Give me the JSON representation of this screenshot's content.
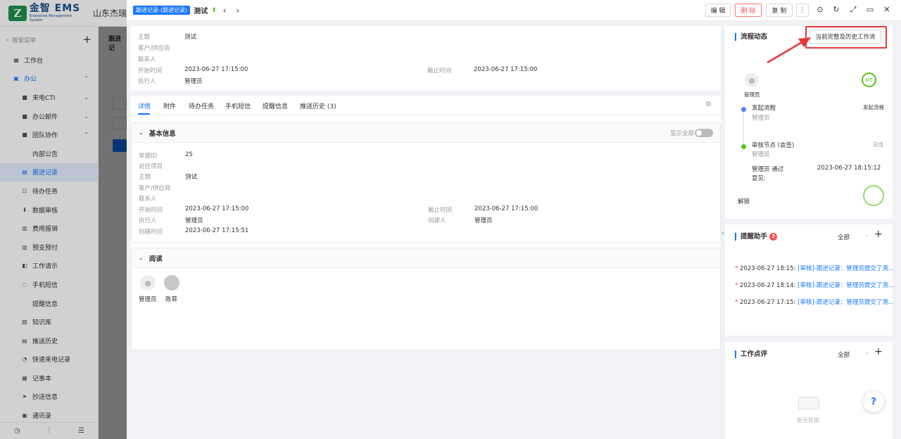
{
  "app": {
    "logo_mark": "Z",
    "name": "金智 EMS",
    "subtitle": "Enterprise Management System",
    "company": "山东杰瑞"
  },
  "sidebar": {
    "search_placeholder": "搜索菜单",
    "items": [
      {
        "label": "工作台",
        "icon": "dashboard-icon"
      },
      {
        "label": "办公",
        "icon": "office-icon"
      },
      {
        "label": "来电CTI",
        "icon": "phone-icon"
      },
      {
        "label": "办公邮件",
        "icon": "mail-icon"
      },
      {
        "label": "团队协作",
        "icon": "team-icon"
      },
      {
        "label": "内部公告"
      },
      {
        "label": "跟进记录",
        "icon": "followup-icon"
      },
      {
        "label": "待办任务",
        "icon": "todo-icon"
      },
      {
        "label": "数据审核",
        "icon": "audit-icon"
      },
      {
        "label": "费用报销",
        "icon": "expense-icon"
      },
      {
        "label": "预支预付",
        "icon": "prepay-icon"
      },
      {
        "label": "工作请示",
        "icon": "request-icon"
      },
      {
        "label": "手机短信",
        "icon": "sms-icon"
      },
      {
        "label": "提醒信息"
      },
      {
        "label": "知识库",
        "icon": "knowledge-icon"
      },
      {
        "label": "推送历史",
        "icon": "push-icon"
      },
      {
        "label": "快速来电记录",
        "icon": "quick-call-icon"
      },
      {
        "label": "记事本",
        "icon": "notebook-icon"
      },
      {
        "label": "抄送信息",
        "icon": "cc-icon"
      },
      {
        "label": "通讯录",
        "icon": "contacts-icon"
      }
    ]
  },
  "bg": {
    "tab_label": "跟进记"
  },
  "drawer": {
    "tag": "跟进记录-(跟进记录)",
    "title": "测试",
    "buttons": {
      "edit": "编 辑",
      "delete": "删 除",
      "copy": "复 制",
      "more": "⋮"
    },
    "summary": {
      "subject_label": "主题",
      "subject_value": "测试",
      "customer_label": "客户/供应商",
      "contact_label": "联系人",
      "start_label": "开始时间",
      "start_value": "2023-06-27 17:15:00",
      "end_label": "截止时间",
      "end_value": "2023-06-27 17:15:00",
      "exec_label": "执行人",
      "exec_value": "管理员"
    },
    "tabs": [
      "详情",
      "附件",
      "待办任务",
      "手机短信",
      "提醒信息",
      "推送历史 (3)"
    ],
    "basic": {
      "title": "基本信息",
      "show_all": "显示全部",
      "id_label": "单据ID",
      "id_value": "25",
      "project_label": "对应项目",
      "subject_label": "主题",
      "subject_value": "测试",
      "customer_label": "客户/供应商",
      "contact_label": "联系人",
      "start_label": "开始时间",
      "start_value": "2023-06-27 17:15:00",
      "end_label": "截止时间",
      "end_value": "2023-06-27 17:15:00",
      "exec_label": "执行人",
      "exec_value": "管理员",
      "creator_label": "创建人",
      "creator_value": "管理员",
      "created_label": "创建时间",
      "created_value": "2023-06-27 17:15:51"
    },
    "read": {
      "title": "阅读",
      "readers": [
        "管理员",
        "陈菲"
      ]
    }
  },
  "workflow": {
    "title": "流程动态",
    "history_button": "当前完整及历史工作流",
    "admin_label": "管理员",
    "badge_text": "MT",
    "step1": {
      "name": "发起流程",
      "sub": "管理员",
      "status": "发起流程"
    },
    "step2": {
      "name": "审核节点 (会签)",
      "sub": "管理员",
      "status": "完成"
    },
    "approve_line": "管理员 通过",
    "approve_time": "2023-06-27 18:15:12",
    "opinion_label": "意见:",
    "unlock": "解锁"
  },
  "reminder": {
    "title": "提醒助手",
    "count": "3",
    "filter": "全部",
    "items": [
      {
        "time": "2023-06-27 18:15:",
        "text": "[审核]-跟进记录：管理员提交了测..."
      },
      {
        "time": "2023-06-27 18:14:",
        "text": "[审核]-跟进记录：管理员提交了测..."
      },
      {
        "time": "2023-06-27 17:15:",
        "text": "[审核]-跟进记录：管理员提交了测..."
      }
    ]
  },
  "comment": {
    "title": "工作点评",
    "filter": "全部",
    "empty": "暂无数据"
  },
  "colors": {
    "primary": "#1677ff",
    "danger": "#ff4d4f",
    "success": "#52c41a",
    "highlight": "#e53935"
  }
}
